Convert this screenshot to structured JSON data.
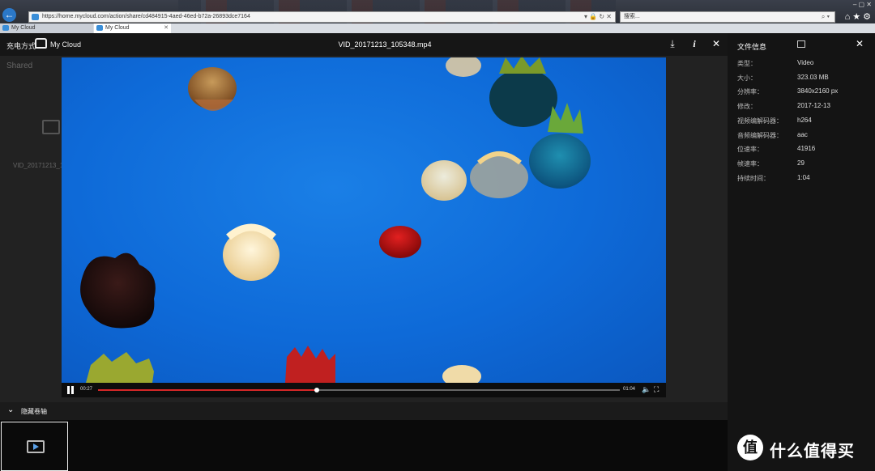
{
  "browser": {
    "url": "https://home.mycloud.com/action/share/cd484915-4aed-46ed-b72a-26893dce7164",
    "search_placeholder": "搜索...",
    "tabs": [
      {
        "label": "My Cloud"
      },
      {
        "label": "My Cloud"
      }
    ]
  },
  "background": {
    "section_label": "Shared",
    "file_name": "VID_20171213_1"
  },
  "viewer": {
    "brand_prefix": "充电方式",
    "brand_name": "My Cloud",
    "file_title": "VID_20171213_105348.mp4",
    "icons": [
      "download-icon",
      "info-icon",
      "close-icon"
    ]
  },
  "player": {
    "current_time": "00:27",
    "duration": "01:04",
    "progress": 0.42,
    "state": "playing"
  },
  "info_panel": {
    "title": "文件信息",
    "rows": [
      {
        "label": "类型：",
        "value": "Video"
      },
      {
        "label": "大小：",
        "value": "323.03 MB"
      },
      {
        "label": "分辨率：",
        "value": "3840x2160 px"
      },
      {
        "label": "修改：",
        "value": "2017-12-13"
      },
      {
        "label": "视频编解码器：",
        "value": "h264"
      },
      {
        "label": "音频编解码器：",
        "value": "aac"
      },
      {
        "label": "位速率：",
        "value": "41916"
      },
      {
        "label": "帧速率：",
        "value": "29"
      },
      {
        "label": "持续时间：",
        "value": "1:04"
      }
    ]
  },
  "filmstrip": {
    "toggle_label": "隐藏卷轴"
  },
  "watermark": {
    "badge": "值",
    "text": "什么值得买"
  },
  "colors": {
    "accent": "#d62828",
    "video_blue": "#0e6ad8"
  }
}
